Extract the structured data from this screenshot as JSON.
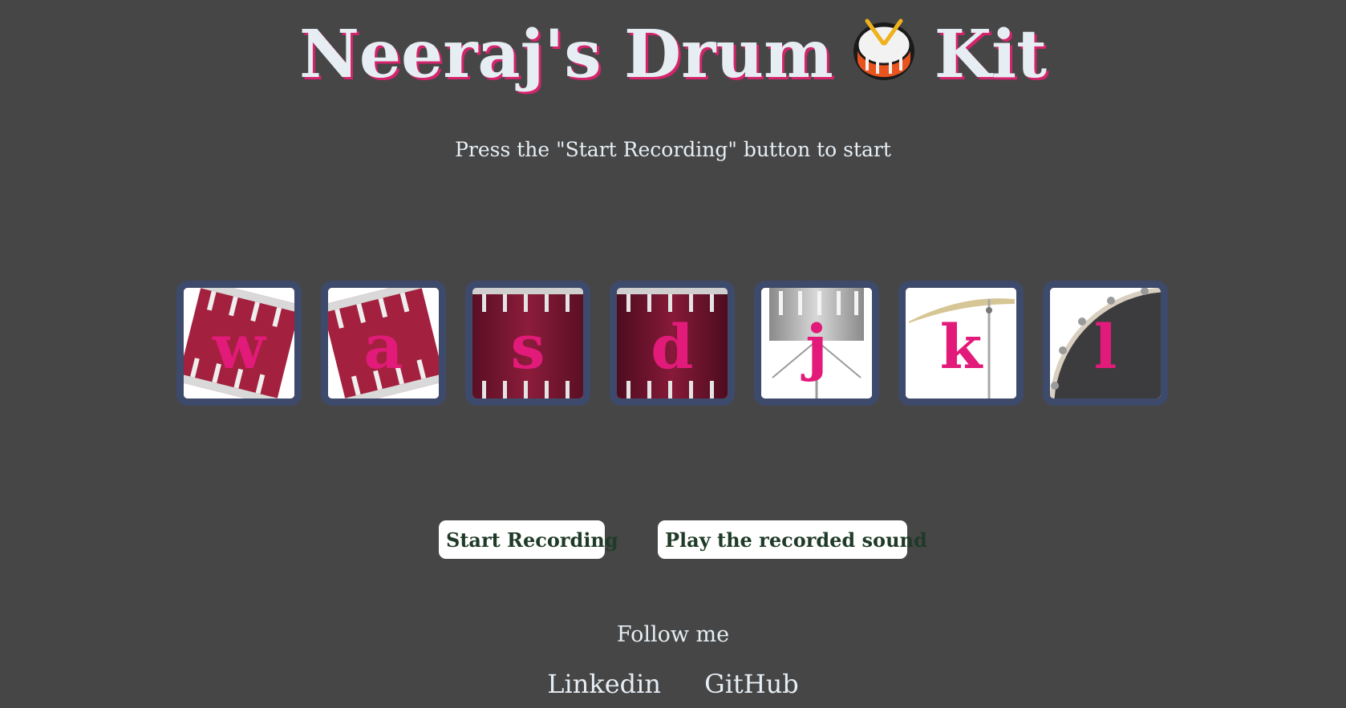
{
  "header": {
    "title_before": "Neeraj's Drum",
    "title_after": "Kit",
    "title_icon": "drum-icon",
    "subtitle": "Press the \"Start Recording\" button to start"
  },
  "pads": [
    {
      "key": "w",
      "image": "tom1-icon"
    },
    {
      "key": "a",
      "image": "tom2-icon"
    },
    {
      "key": "s",
      "image": "tom3-icon"
    },
    {
      "key": "d",
      "image": "tom4-icon"
    },
    {
      "key": "j",
      "image": "snare-icon"
    },
    {
      "key": "k",
      "image": "crash-icon"
    },
    {
      "key": "l",
      "image": "kick-icon"
    }
  ],
  "controls": {
    "record_label": "Start Recording",
    "play_label": "Play the recorded sound"
  },
  "footer": {
    "follow_label": "Follow me",
    "linkedin_label": "Linkedin",
    "github_label": "GitHub"
  },
  "colors": {
    "background": "#464646",
    "title_shadow": "#d4246c",
    "key_letter": "#e21a79",
    "pad_border": "#3e4a6b",
    "button_text": "#1f3b28"
  }
}
